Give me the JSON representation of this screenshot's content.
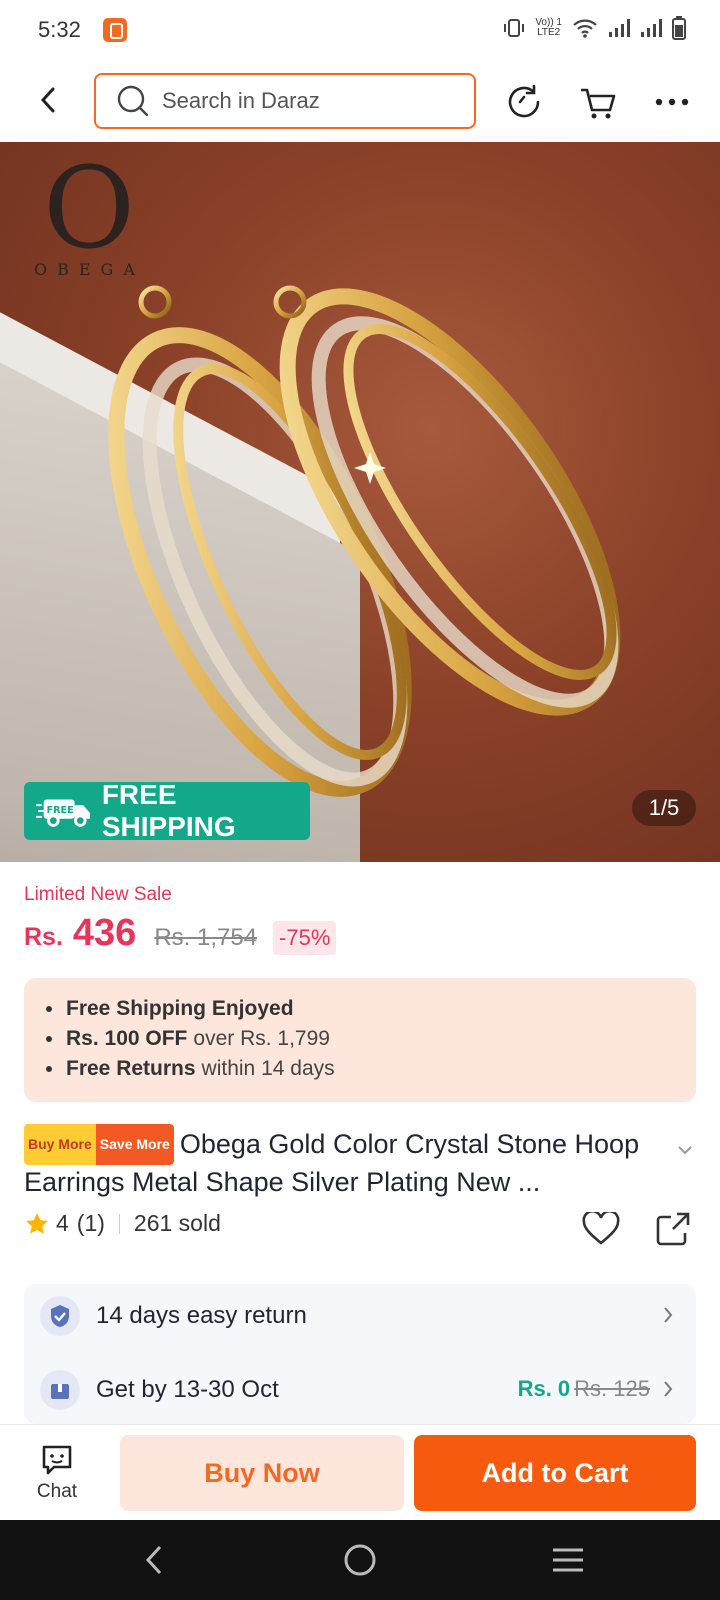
{
  "status_bar": {
    "time": "5:32",
    "lte_line1": "Vo)) 1",
    "lte_line2": "LTE2"
  },
  "search": {
    "placeholder": "Search in Daraz"
  },
  "hero": {
    "brand_letter": "O",
    "brand_name": "OBEGA",
    "free_shipping_badge_small": "FREE",
    "free_shipping_label": "FREE SHIPPING",
    "image_counter": "1/5"
  },
  "price": {
    "sale_label": "Limited New Sale",
    "currency": "Rs.",
    "current": "436",
    "original": "Rs. 1,754",
    "discount": "-75%"
  },
  "promos": [
    {
      "bold": "Free Shipping Enjoyed",
      "rest": ""
    },
    {
      "bold": "Rs. 100 OFF",
      "rest": "over Rs. 1,799"
    },
    {
      "bold": "Free Returns",
      "rest": "within 14 days"
    }
  ],
  "product": {
    "tag_buy_more": "Buy More",
    "tag_save_more": "Save More",
    "title": "Obega Gold Color Crystal Stone Hoop Earrings  Metal Shape Silver Plating New ..."
  },
  "rating": {
    "score": "4",
    "count": "(1)",
    "sold": "261 sold"
  },
  "services": {
    "return_text": "14 days easy return",
    "delivery_text": "Get by 13-30 Oct",
    "delivery_price": "Rs. 0",
    "delivery_original": "Rs. 125"
  },
  "actions": {
    "chat": "Chat",
    "buy_now": "Buy Now",
    "add_to_cart": "Add to Cart"
  },
  "colors": {
    "accent": "#f26a21",
    "sale": "#e6355a",
    "teal": "#13a88a",
    "cta": "#f55a0e"
  }
}
